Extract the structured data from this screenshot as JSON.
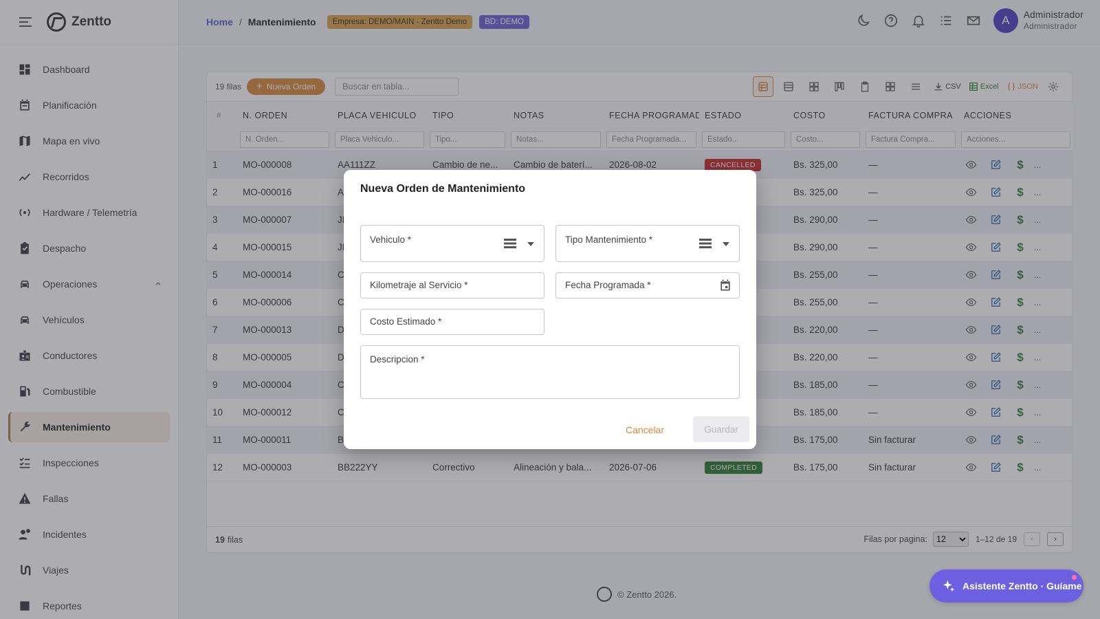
{
  "brand": {
    "name": "Zentto"
  },
  "sidebar": {
    "items": [
      {
        "label": "Dashboard",
        "icon": "dashboard-icon"
      },
      {
        "label": "Planificación",
        "icon": "calendar-icon"
      },
      {
        "label": "Mapa en vivo",
        "icon": "map-icon"
      },
      {
        "label": "Recorridos",
        "icon": "route-chart-icon"
      },
      {
        "label": "Hardware / Telemetría",
        "icon": "signal-icon"
      },
      {
        "label": "Despacho",
        "icon": "clipboard-check-icon"
      },
      {
        "label": "Operaciones",
        "icon": "car-icon"
      },
      {
        "label": "Vehículos",
        "icon": "car-icon"
      },
      {
        "label": "Conductores",
        "icon": "badge-icon"
      },
      {
        "label": "Combustible",
        "icon": "fuel-icon"
      },
      {
        "label": "Mantenimiento",
        "icon": "wrench-icon"
      },
      {
        "label": "Inspecciones",
        "icon": "checklist-icon"
      },
      {
        "label": "Fallas",
        "icon": "warning-icon"
      },
      {
        "label": "Incidentes",
        "icon": "person-alert-icon"
      },
      {
        "label": "Viajes",
        "icon": "route-icon"
      },
      {
        "label": "Reportes",
        "icon": "report-icon"
      }
    ]
  },
  "header": {
    "home": "Home",
    "separator": "/",
    "current": "Mantenimiento",
    "empresa_badge": "Empresa: DEMO/MAIN - Zentto Demo",
    "bd_badge": "BD: DEMO",
    "user_initial": "A",
    "user_name": "Administrador",
    "user_role": "Administrador"
  },
  "toolbar": {
    "rows_label": "19 filas",
    "new_button": "Nueva Orden",
    "search_placeholder": "Buscar en tabla...",
    "csv": "CSV",
    "excel": "Excel",
    "json": "JSON"
  },
  "table": {
    "columns": [
      "#",
      "N. ORDEN",
      "PLACA VEHICULO",
      "TIPO",
      "NOTAS",
      "FECHA PROGRAMADA",
      "ESTADO",
      "COSTO",
      "FACTURA COMPRA",
      "ACCIONES"
    ],
    "filters": [
      "N. Orden...",
      "Placa Vehiculo...",
      "Tipo...",
      "Notas...",
      "Fecha Programada...",
      "Estado...",
      "Costo...",
      "Factura Compra...",
      "Acciones..."
    ],
    "rows": [
      {
        "idx": "1",
        "orden": "MO-000008",
        "placa": "AA111ZZ",
        "tipo": "Cambio de ne...",
        "notas": "Cambio de baterí...",
        "fecha": "2026-08-02",
        "estado": "CANCELLED",
        "estado_class": "cancelled",
        "costo": "Bs. 325,00",
        "factura": "—"
      },
      {
        "idx": "2",
        "orden": "MO-000016",
        "placa": "A",
        "tipo": "",
        "notas": "",
        "fecha": "",
        "estado": "",
        "estado_class": "cancelled",
        "costo": "Bs. 325,00",
        "factura": "—"
      },
      {
        "idx": "3",
        "orden": "MO-000007",
        "placa": "JI",
        "tipo": "",
        "notas": "",
        "fecha": "",
        "estado": "",
        "estado_class": "cancelled",
        "costo": "Bs. 290,00",
        "factura": "—"
      },
      {
        "idx": "4",
        "orden": "MO-000015",
        "placa": "JI",
        "tipo": "",
        "notas": "",
        "fecha": "",
        "estado": "",
        "estado_class": "cancelled",
        "costo": "Bs. 290,00",
        "factura": "—"
      },
      {
        "idx": "5",
        "orden": "MO-000014",
        "placa": "C",
        "tipo": "",
        "notas": "",
        "fecha": "",
        "estado": "",
        "estado_class": "pending",
        "costo": "Bs. 255,00",
        "factura": "—"
      },
      {
        "idx": "6",
        "orden": "MO-000006",
        "placa": "C",
        "tipo": "",
        "notas": "",
        "fecha": "",
        "estado": "",
        "estado_class": "pending",
        "costo": "Bs. 255,00",
        "factura": "—"
      },
      {
        "idx": "7",
        "orden": "MO-000013",
        "placa": "D",
        "tipo": "",
        "notas": "",
        "fecha": "",
        "estado": "",
        "estado_class": "pending",
        "costo": "Bs. 220,00",
        "factura": "—"
      },
      {
        "idx": "8",
        "orden": "MO-000005",
        "placa": "D",
        "tipo": "",
        "notas": "",
        "fecha": "",
        "estado": "",
        "estado_class": "pending",
        "costo": "Bs. 220,00",
        "factura": "—"
      },
      {
        "idx": "9",
        "orden": "MO-000004",
        "placa": "C",
        "tipo": "",
        "notas": "",
        "fecha": "",
        "estado": "",
        "estado_class": "pending",
        "costo": "Bs. 185,00",
        "factura": "—"
      },
      {
        "idx": "10",
        "orden": "MO-000012",
        "placa": "C",
        "tipo": "",
        "notas": "",
        "fecha": "",
        "estado": "",
        "estado_class": "pending",
        "costo": "Bs. 185,00",
        "factura": "—"
      },
      {
        "idx": "11",
        "orden": "MO-000011",
        "placa": "B",
        "tipo": "",
        "notas": "",
        "fecha": "",
        "estado": "",
        "estado_class": "completed",
        "costo": "Bs. 175,00",
        "factura": "Sin facturar"
      },
      {
        "idx": "12",
        "orden": "MO-000003",
        "placa": "BB222YY",
        "tipo": "Correctivo",
        "notas": "Alineación y bala...",
        "fecha": "2026-07-06",
        "estado": "COMPLETED",
        "estado_class": "completed",
        "costo": "Bs. 175,00",
        "factura": "Sin facturar"
      }
    ]
  },
  "footer": {
    "count": "19",
    "count_label": "filas",
    "per_page_label": "Filas por pagina:",
    "per_page_value": "12",
    "range": "1–12 de 19",
    "prev": "‹",
    "next": "›"
  },
  "page_footer": {
    "text": "© Zentto 2026."
  },
  "assistant": {
    "label": "Asistente Zentto · Guíame"
  },
  "modal": {
    "title": "Nueva Orden de Mantenimiento",
    "fields": {
      "vehiculo": "Vehiculo *",
      "tipo": "Tipo Mantenimiento *",
      "kilometraje": "Kilometraje al Servicio *",
      "fecha": "Fecha Programada *",
      "costo": "Costo Estimado *",
      "descripcion": "Descripcion *"
    },
    "cancel": "Cancelar",
    "save": "Guardar"
  },
  "colors": {
    "accent": "#d8893a",
    "brand_purple": "#6c5fe0",
    "link": "#5c5fbf"
  }
}
